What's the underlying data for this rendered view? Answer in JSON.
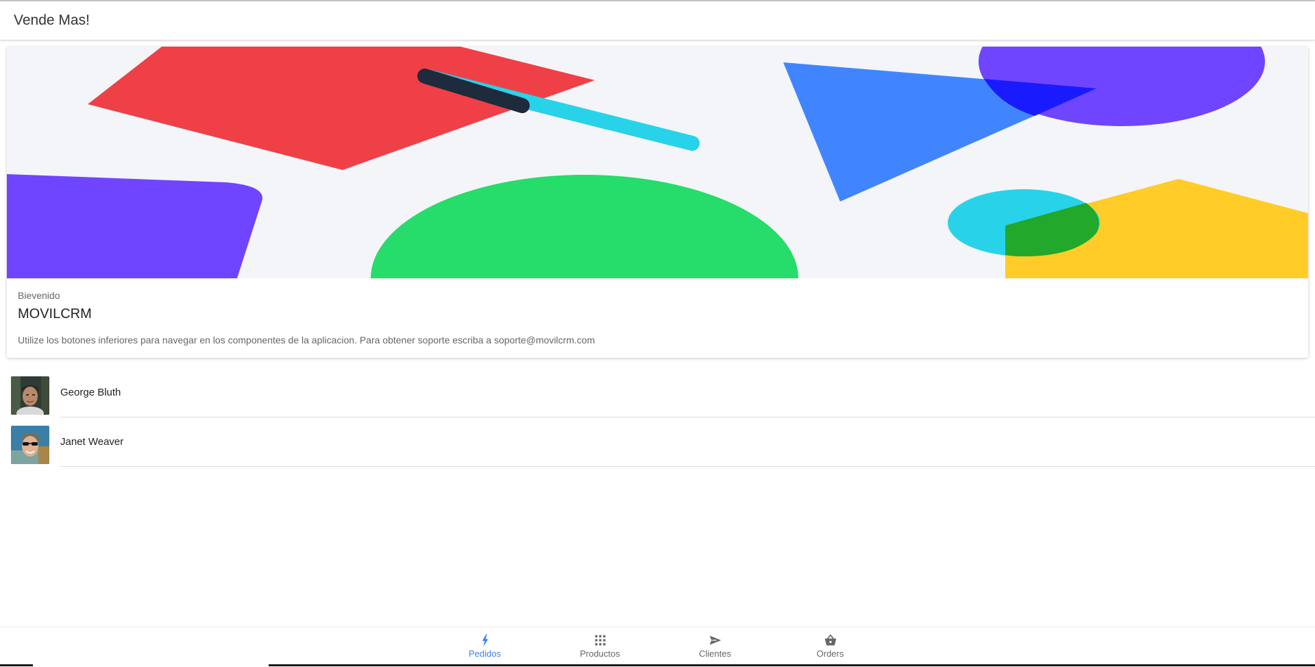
{
  "header": {
    "title": "Vende Mas!"
  },
  "card": {
    "subtitle": "Bievenido",
    "title": "MOVILCRM",
    "content": "Utilize los botones inferiores para navegar en los componentes de la aplicacion. Para obtener soporte escriba a soporte@movilcrm.com"
  },
  "contacts": [
    {
      "name": "George Bluth"
    },
    {
      "name": "Janet Weaver"
    }
  ],
  "tabs": [
    {
      "label": "Pedidos",
      "icon": "flash-icon",
      "active": true
    },
    {
      "label": "Productos",
      "icon": "apps-grid-icon",
      "active": false
    },
    {
      "label": "Clientes",
      "icon": "send-icon",
      "active": false
    },
    {
      "label": "Orders",
      "icon": "basket-icon",
      "active": false
    }
  ],
  "colors": {
    "accent": "#3880ff",
    "red": "#ef4047",
    "cyan": "#28d3ea",
    "purple": "#7045ff",
    "blue": "#3d83fe",
    "green": "#26dc6a",
    "yellow": "#ffcc28"
  }
}
